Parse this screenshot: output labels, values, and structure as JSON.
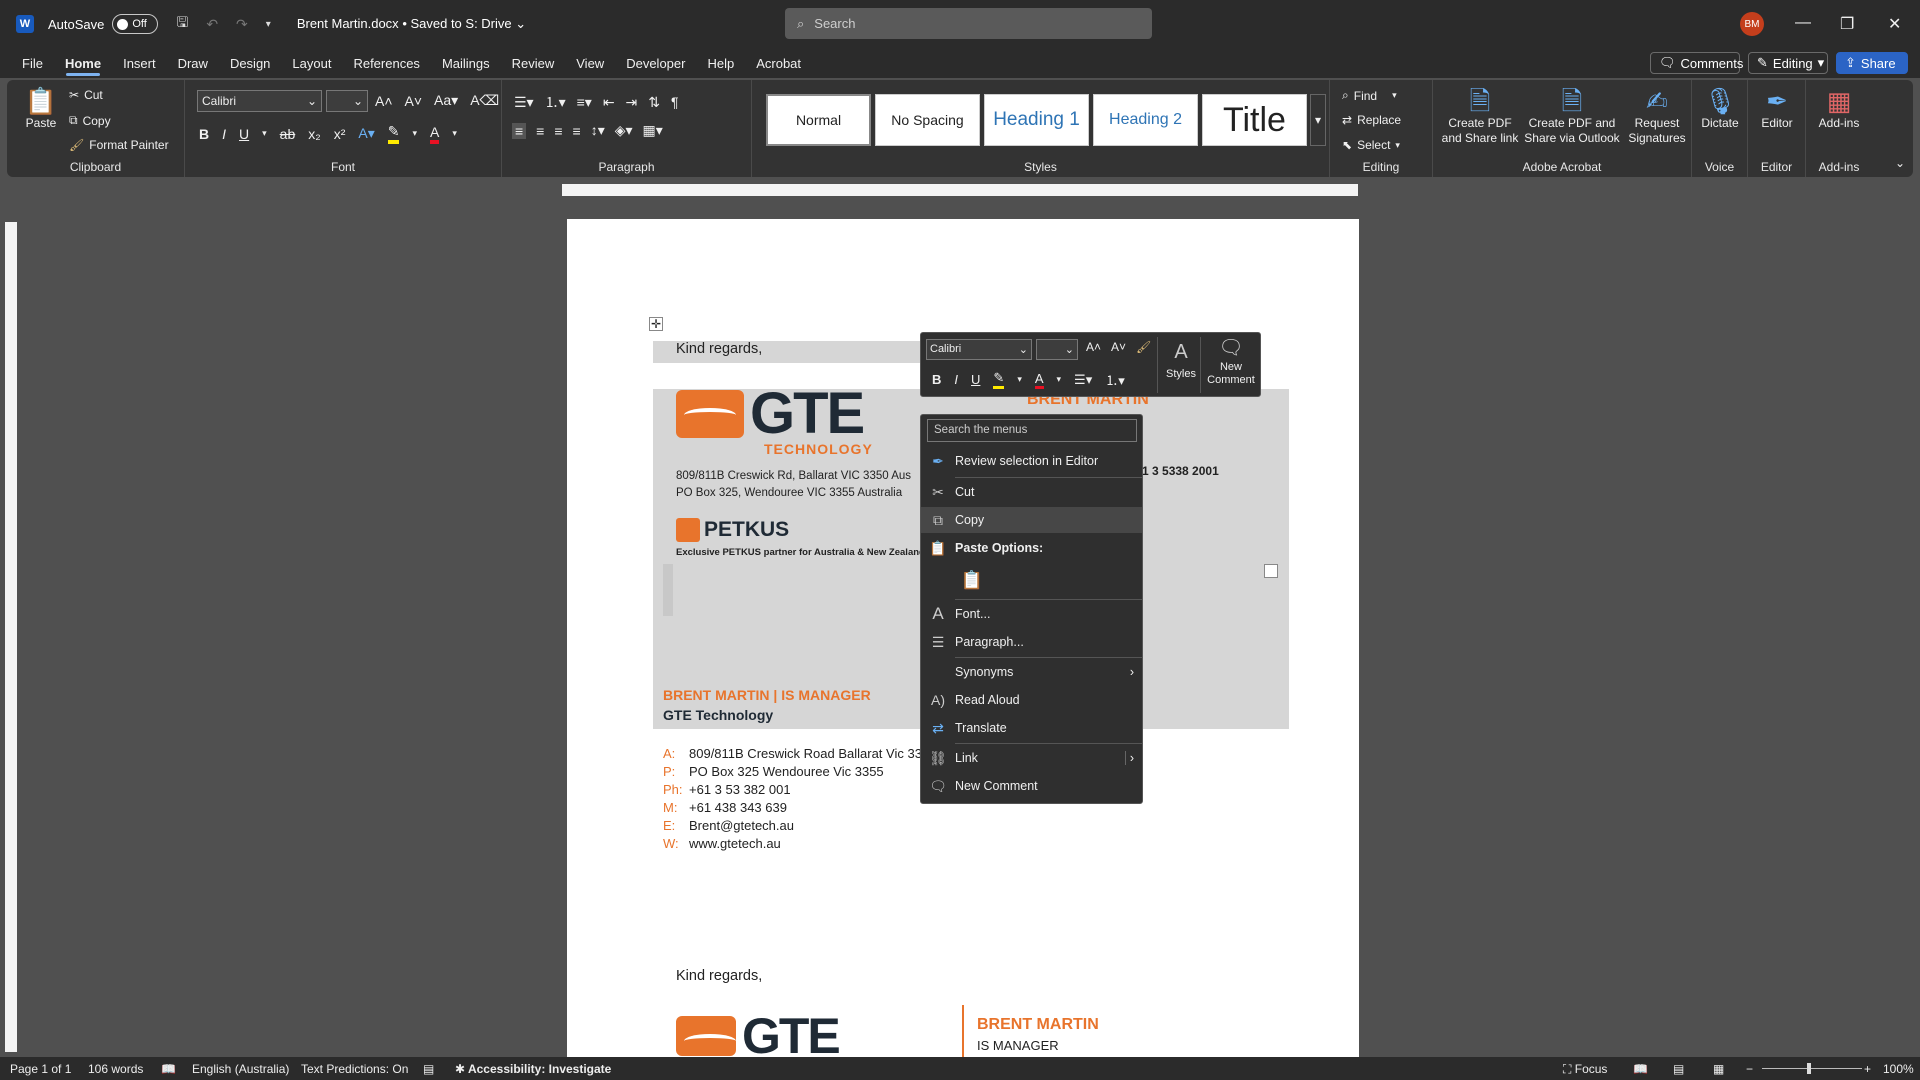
{
  "titlebar": {
    "app_logo": "W",
    "autosave_label": "AutoSave",
    "autosave_state": "Off",
    "doc_title": "Brent Martin.docx",
    "saved_status": "• Saved to S: Drive",
    "search_placeholder": "Search",
    "avatar_initials": "BM"
  },
  "menu": {
    "tabs": [
      "File",
      "Home",
      "Insert",
      "Draw",
      "Design",
      "Layout",
      "References",
      "Mailings",
      "Review",
      "View",
      "Developer",
      "Help",
      "Acrobat"
    ],
    "comments_label": "Comments",
    "editing_label": "Editing",
    "share_label": "Share"
  },
  "ribbon": {
    "clipboard": {
      "paste": "Paste",
      "cut": "Cut",
      "copy": "Copy",
      "format_painter": "Format Painter",
      "label": "Clipboard"
    },
    "font": {
      "name": "Calibri",
      "size": "",
      "label": "Font"
    },
    "paragraph": {
      "label": "Paragraph"
    },
    "styles": {
      "items": [
        "Normal",
        "No Spacing",
        "Heading 1",
        "Heading 2",
        "Title"
      ],
      "label": "Styles"
    },
    "editing": {
      "find": "Find",
      "replace": "Replace",
      "select": "Select",
      "label": "Editing"
    },
    "acrobat": {
      "create_pdf_1": "Create PDF",
      "create_pdf_2": "and Share link",
      "create_outlook_1": "Create PDF and",
      "create_outlook_2": "Share via Outlook",
      "request_1": "Request",
      "request_2": "Signatures",
      "label": "Adobe Acrobat"
    },
    "voice": {
      "dictate": "Dictate",
      "label": "Voice"
    },
    "editor": {
      "editor": "Editor",
      "label": "Editor"
    },
    "addins": {
      "addins": "Add-ins",
      "label": "Add-ins"
    }
  },
  "document": {
    "kind_regards": "Kind regards,",
    "name_upper": "BRENT MARTIN",
    "address_line1": "809/811B Creswick Rd, Ballarat VIC 3350 Aus",
    "address_line2": "PO Box 325, Wendouree VIC 3355 Australia",
    "phone_partial": "1 3 5338 2001",
    "petkus": "PETKUS",
    "petkus_tagline": "Exclusive PETKUS partner for Australia & New Zealand",
    "gte_word": "GTE",
    "gte_sub": "TECHNOLOGY",
    "sig_name_title": "BRENT MARTIN | IS MANAGER",
    "sig_company": "GTE Technology",
    "contacts": [
      {
        "label": "A:",
        "value": "809/811B Creswick Road Ballarat Vic 33"
      },
      {
        "label": "P:",
        "value": "PO Box 325 Wendouree Vic 3355"
      },
      {
        "label": "Ph:",
        "value": "+61 3 53 382 001"
      },
      {
        "label": "M:",
        "value": "+61 438 343 639"
      },
      {
        "label": "E:",
        "value": "Brent@gtetech.au"
      },
      {
        "label": "W:",
        "value": "www.gtetech.au"
      }
    ],
    "kind_regards_2": "Kind regards,",
    "name_2": "BRENT MARTIN",
    "title_2": "IS MANAGER"
  },
  "mini_toolbar": {
    "font": "Calibri",
    "styles": "Styles",
    "new_comment_1": "New",
    "new_comment_2": "Comment"
  },
  "context_menu": {
    "search_placeholder": "Search the menus",
    "review": "Review selection in Editor",
    "cut": "Cut",
    "copy": "Copy",
    "paste_options": "Paste Options:",
    "font": "Font...",
    "paragraph": "Paragraph...",
    "synonyms": "Synonyms",
    "read_aloud": "Read Aloud",
    "translate": "Translate",
    "link": "Link",
    "new_comment": "New Comment"
  },
  "statusbar": {
    "page": "Page 1 of 1",
    "words": "106 words",
    "language": "English (Australia)",
    "predictions": "Text Predictions: On",
    "accessibility": "Accessibility: Investigate",
    "focus": "Focus",
    "zoom": "100%"
  },
  "colors": {
    "accent": "#e8742c",
    "brand_dark": "#1f2a35",
    "word_blue": "#185abd"
  }
}
